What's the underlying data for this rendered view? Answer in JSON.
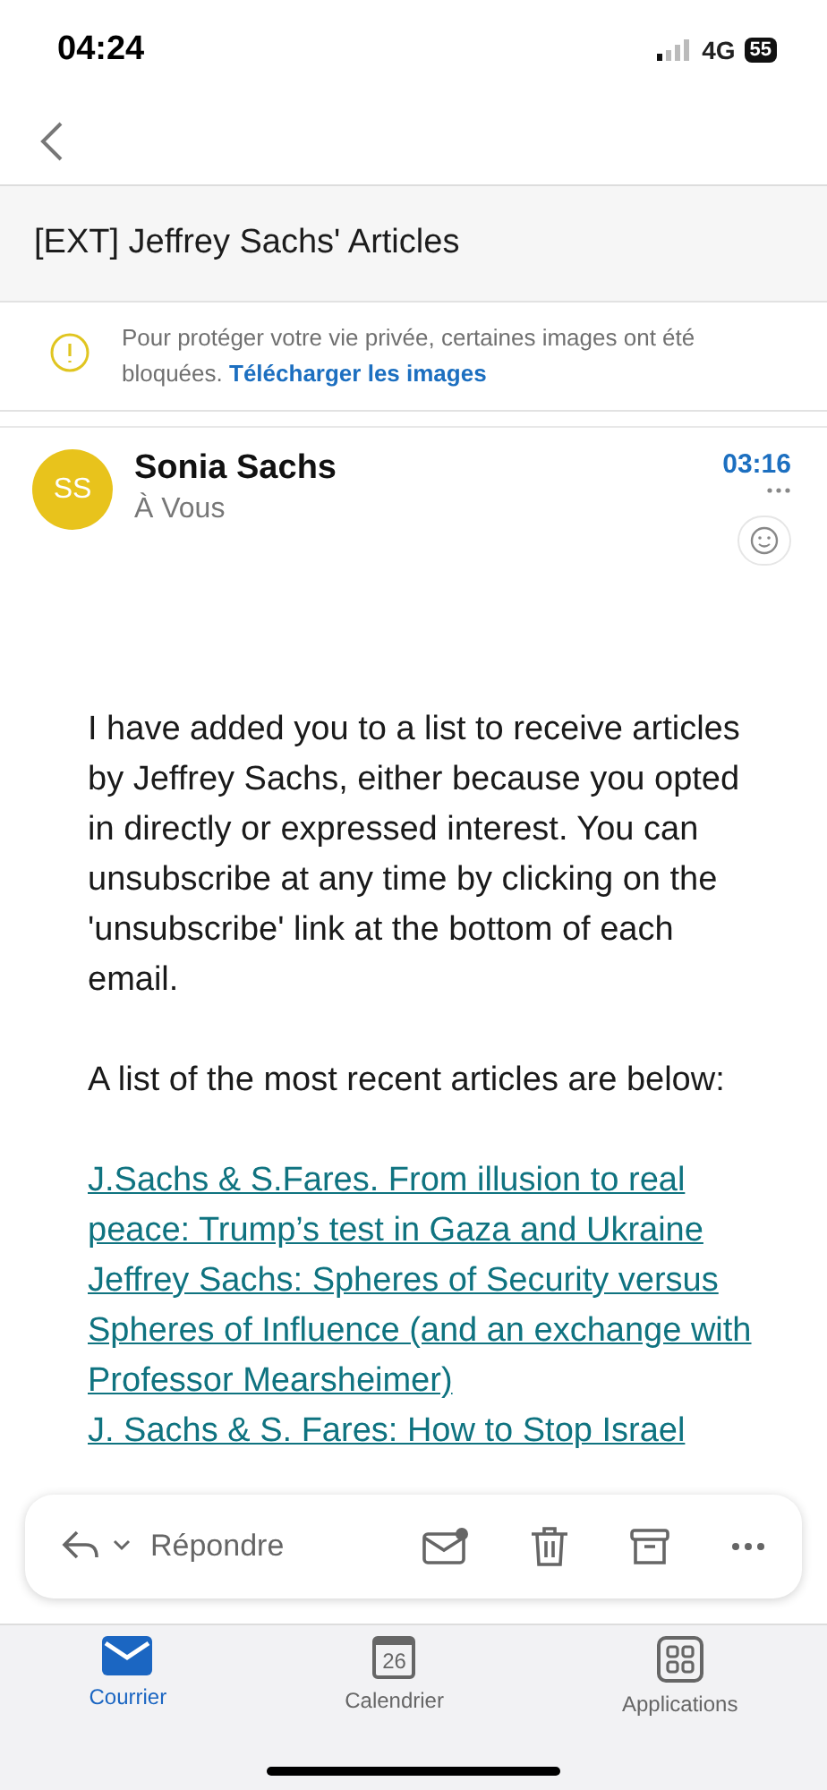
{
  "status_bar": {
    "time": "04:24",
    "network": "4G",
    "battery": "55"
  },
  "subject": "[EXT] Jeffrey Sachs' Articles",
  "notice": {
    "text": "Pour protéger votre vie privée, certaines images ont été bloquées.",
    "link": "Télécharger les images"
  },
  "message": {
    "avatar_initials": "SS",
    "sender": "Sonia Sachs",
    "recipient": "À Vous",
    "time": "03:16",
    "paragraphs": [
      "I have added you to a list to receive articles by Jeffrey Sachs, either because you opted in directly or expressed interest.  You can unsubscribe at any time by clicking on the 'unsubscribe' link at the bottom of each email.",
      "A list of the most recent articles are below:"
    ],
    "links": [
      "J.Sachs & S.Fares. From illusion to real peace: Trump’s test in Gaza and Ukraine",
      "Jeffrey Sachs: Spheres of Security versus Spheres of Influence (and an exchange with Professor Mearsheimer)",
      "J. Sachs & S. Fares: How to Stop Israel"
    ]
  },
  "action_bar": {
    "reply": "Répondre"
  },
  "tabs": [
    {
      "label": "Courrier",
      "selected": true,
      "kind": "mail"
    },
    {
      "label": "Calendrier",
      "selected": false,
      "kind": "calendar",
      "day": "26"
    },
    {
      "label": "Applications",
      "selected": false,
      "kind": "apps"
    }
  ]
}
